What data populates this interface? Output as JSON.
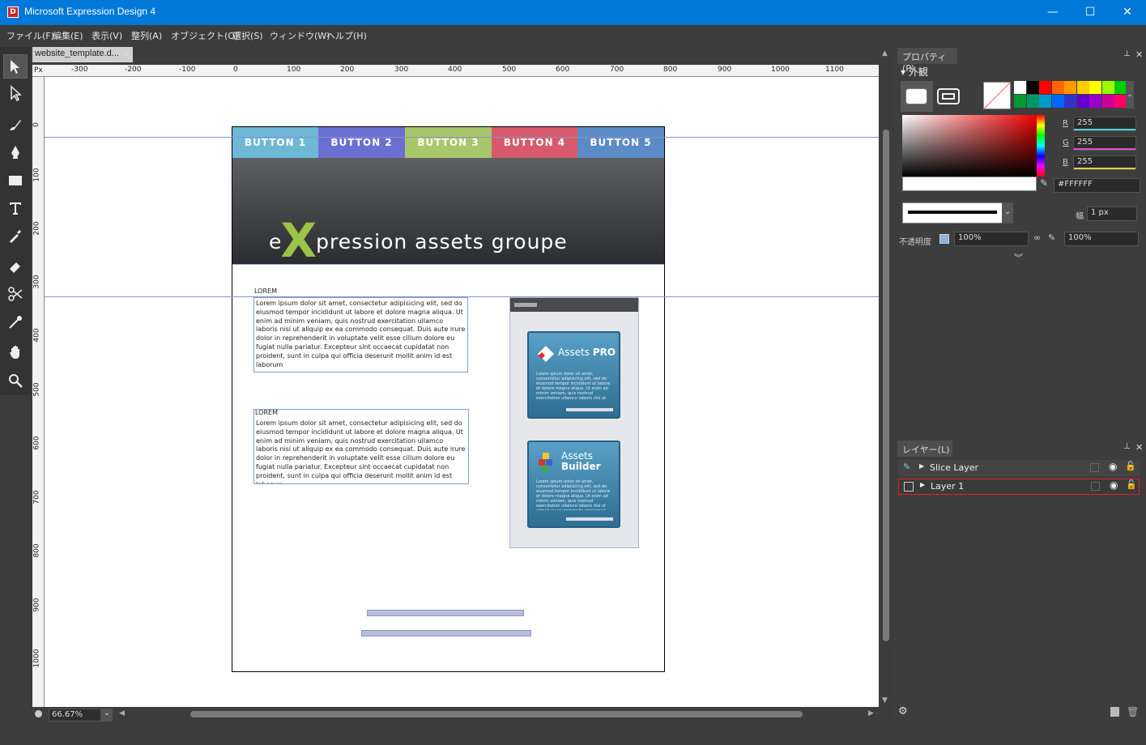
{
  "window": {
    "title": "Microsoft Expression Design 4",
    "icon_label": "D",
    "controls": [
      "—",
      "☐",
      "✕"
    ]
  },
  "menu": [
    "ファイル(F)",
    "編集(E)",
    "表示(V)",
    "整列(A)",
    "オブジェクト(O)",
    "選択(S)",
    "ウィンドウ(W)",
    "ヘルプ(H)"
  ],
  "document": {
    "tab_name": "website_template.d...",
    "close_glyph": "×",
    "ruler_unit": "Px",
    "ruler_h_labels": [
      "-300",
      "-200",
      "-100",
      "0",
      "100",
      "200",
      "300",
      "400",
      "500",
      "600",
      "700",
      "800",
      "900",
      "1000",
      "1100"
    ],
    "ruler_v_labels": [
      "0",
      "100",
      "200",
      "300",
      "400",
      "500",
      "600",
      "700",
      "800",
      "900",
      "1000"
    ],
    "zoom": "66.67%"
  },
  "artboard": {
    "nav_buttons": [
      {
        "label": "BUTTON 1",
        "color": "#6db8d6"
      },
      {
        "label": "BUTTON 2",
        "color": "#6a6fd2"
      },
      {
        "label": "BUTTON 3",
        "color": "#a8c76a"
      },
      {
        "label": "BUTTON 4",
        "color": "#d65a6a"
      },
      {
        "label": "BUTTON 5",
        "color": "#5a8bc6"
      }
    ],
    "hero": {
      "prefix": "e",
      "x_letter": "X",
      "suffix": "pression assets groupe",
      "accent": "#9ac348"
    },
    "sections": [
      {
        "label": "LOREM",
        "body": "Lorem ipsum dolor sit amet, consectetur adipisicing elit, sed do eiusmod tempor incididunt ut labore et dolore magna aliqua. Ut enim ad minim veniam, quis nostrud exercitation ullamco laboris nisi ut aliquip ex ea commodo consequat. Duis aute irure dolor in reprehenderit in voluptate velit esse cillum dolore eu fugiat nulla pariatur. Excepteur sint occaecat cupidatat non proident, sunt in culpa qui officia deserunt mollit anim id est laborum"
      },
      {
        "label": "LOREM",
        "body": "Lorem ipsum dolor sit amet, consectetur adipisicing elit, sed do eiusmod tempor incididunt ut labore et dolore magna aliqua. Ut enim ad minim veniam, quis nostrud exercitation ullamco laboris nisi ut aliquip ex ea commodo consequat. Duis aute irure dolor in reprehenderit in voluptate velit esse cillum dolore eu fugiat nulla pariatur. Excepteur sint occaecat cupidatat non proident, sunt in culpa qui officia deserunt mollit anim id est laborum"
      }
    ],
    "products": [
      {
        "name_a": "Assets",
        "name_b": "PRO",
        "desc": "Lorem ipsum dolor sit amet, consectetur adipisicing elit, sed do eiusmod tempor incididunt ut labore et dolore magna aliqua. Ut enim ad minim veniam, quis nostrud exercitation ullamco laboris nisi ut aliquip ex ea commodo consequat. Duis aute irure dolor in reprehenderit"
      },
      {
        "name_a": "Assets",
        "name_b": "Builder",
        "desc": "Lorem ipsum dolor sit amet, consectetur adipisicing elit, sed do eiusmod tempor incididunt ut labore et dolore magna aliqua. Ut enim ad minim veniam, quis nostrud exercitation ullamco laboris nisi ut aliquip ex ea commodo consequat. Duis aute irure dolor in reprehenderit"
      }
    ]
  },
  "properties_panel": {
    "tab": "プロパティ(P)",
    "section": "外観",
    "rgb": [
      {
        "label": "R",
        "value": "255",
        "color": "#4fd1d9"
      },
      {
        "label": "G",
        "value": "255",
        "color": "#d94fd1"
      },
      {
        "label": "B",
        "value": "255",
        "color": "#d9d14f"
      }
    ],
    "hex": "#FFFFFF",
    "width_label": "幅",
    "width_value": "1 px",
    "opacity_label": "不透明度",
    "opacity_value": "100%",
    "opacity_value_2": "100%",
    "swatches": [
      "#ffffff",
      "#000000",
      "#ff0000",
      "#ff6600",
      "#ff9900",
      "#ffcc00",
      "#ffff00",
      "#99ff00",
      "#00cc00",
      "#009933",
      "#009966",
      "#0099cc",
      "#0066ff",
      "#3333cc",
      "#6600cc",
      "#9900cc",
      "#cc0099",
      "#ff0066"
    ]
  },
  "layers_panel": {
    "tab": "レイヤー(L)",
    "layers": [
      {
        "name": "Slice Layer",
        "selected": false
      },
      {
        "name": "Layer 1",
        "selected": true
      }
    ]
  }
}
